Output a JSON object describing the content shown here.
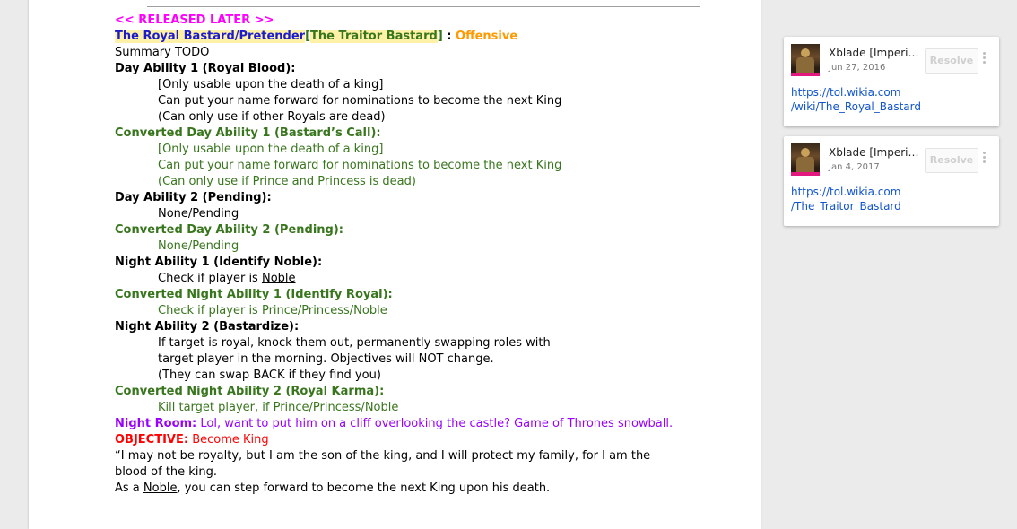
{
  "document": {
    "released_later": "<< RELEASED LATER >>",
    "title_role": "The Royal Bastard/Pretender",
    "title_open": "[",
    "title_converted_prefix": "The ",
    "title_converted_name": "Traitor Bastard",
    "title_close": "]",
    "title_sep": " : ",
    "title_alignment": "Offensive",
    "summary": "Summary TODO",
    "day1_header": "Day Ability 1 (Royal Blood):",
    "day1_lines": [
      "[Only usable upon the death of a king]",
      "Can put your name forward for nominations to become the next King",
      "(Can only use if other Royals are dead)"
    ],
    "cday1_header": "Converted Day Ability 1 (Bastard’s Call):",
    "cday1_lines": [
      "[Only usable upon the death of a king]",
      "Can put your name forward for nominations to become the next King",
      "(Can only use if Prince and Princess is dead)"
    ],
    "day2_header": "Day Ability 2 (Pending):",
    "day2_line": "None/Pending",
    "cday2_header": "Converted Day Ability 2 (Pending):",
    "cday2_line": "None/Pending",
    "night1_header": "Night Ability 1 (Identify Noble):",
    "night1_prefix": "Check if player is ",
    "night1_link": "Noble",
    "cnight1_header": "Converted Night Ability 1 (Identify Royal):",
    "cnight1_line": "Check if player is Prince/Princess/Noble",
    "night2_header": "Night Ability 2 (Bastardize):",
    "night2_lines": [
      "If target is royal, knock them out, permanently swapping roles with",
      "target player in the morning. Objectives will NOT change.",
      "(They can swap BACK if they find you)"
    ],
    "cnight2_header": "Converted Night Ability 2 (Royal Karma):",
    "cnight2_line": "Kill target player, if Prince/Princess/Noble",
    "night_room_label": "Night Room:",
    "night_room_text": " Lol, want to put him on a cliff overlooking the castle? Game of Thrones snowball.",
    "objective_label": "OBJECTIVE:",
    "objective_text": " Become King",
    "quote": "“I may not be royalty, but I am the son of the king, and I will protect my family, for I am the blood of the king.",
    "closing_prefix": "As a ",
    "closing_link": "Noble",
    "closing_suffix": ", you can step forward to become the next King upon his death."
  },
  "comments": [
    {
      "author": "Xblade [Imperium]",
      "date": "Jun 27, 2016",
      "resolve_label": "Resolve",
      "text_line1": "https://tol.wikia.com",
      "text_line2": "/wiki/The_Royal_Bastard"
    },
    {
      "author": "Xblade [Imperium]",
      "date": "Jan 4, 2017",
      "resolve_label": "Resolve",
      "text_line1": "https://tol.wikia.com",
      "text_line2": "/The_Traitor_Bastard"
    }
  ],
  "colors": {
    "green": "#38761d",
    "purple": "#9900ff",
    "red": "#ff0000",
    "orange": "#ff9900",
    "magenta": "#ff00ff",
    "blue": "#1c1ccc",
    "link": "#1155cc"
  }
}
